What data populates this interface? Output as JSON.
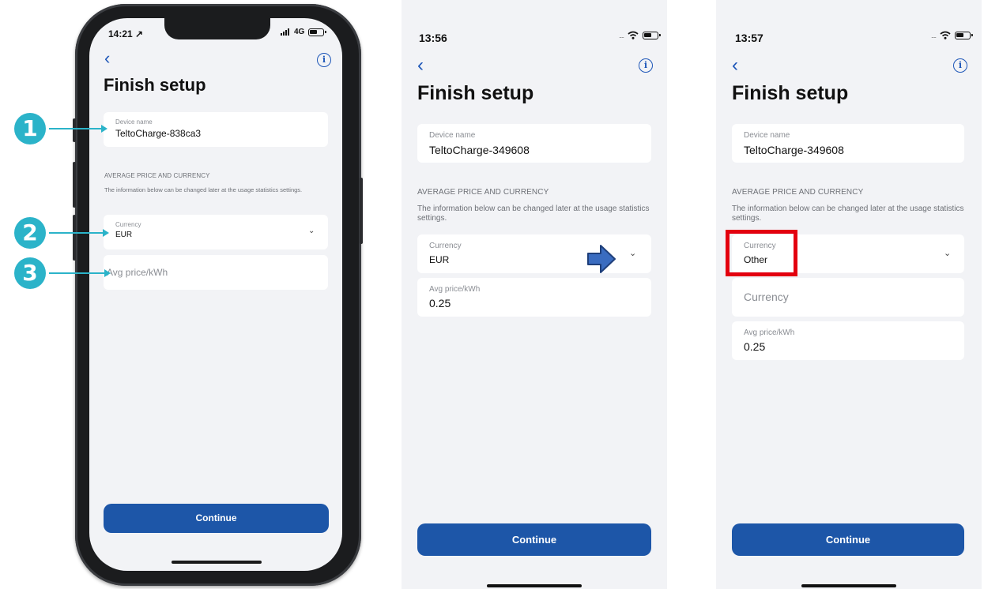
{
  "colors": {
    "accent": "#1d56a8",
    "callout": "#2bb3c9",
    "highlight": "#e3000f",
    "background": "#f2f3f6"
  },
  "screen1": {
    "time": "14:21 ↗",
    "status": "4G",
    "title": "Finish setup",
    "device_label": "Device name",
    "device_value": "TeltoCharge-838ca3",
    "section": "AVERAGE PRICE AND CURRENCY",
    "description": "The information below can be changed later at the usage statistics settings.",
    "currency_label": "Currency",
    "currency_value": "EUR",
    "avg_placeholder": "Avg price/kWh",
    "continue": "Continue",
    "callouts": [
      "1",
      "2",
      "3"
    ]
  },
  "screen2": {
    "time": "13:56",
    "title": "Finish setup",
    "device_label": "Device name",
    "device_value": "TeltoCharge-349608",
    "section": "AVERAGE PRICE AND CURRENCY",
    "description": "The information below can be changed later at the usage statistics settings.",
    "currency_label": "Currency",
    "currency_value": "EUR",
    "avg_label": "Avg price/kWh",
    "avg_value": "0.25",
    "continue": "Continue"
  },
  "screen3": {
    "time": "13:57",
    "title": "Finish setup",
    "device_label": "Device name",
    "device_value": "TeltoCharge-349608",
    "section": "AVERAGE PRICE AND CURRENCY",
    "description": "The information below can be changed later at the usage statistics settings.",
    "currency_label": "Currency",
    "currency_value": "Other",
    "currency_custom_placeholder": "Currency",
    "avg_label": "Avg price/kWh",
    "avg_value": "0.25",
    "continue": "Continue"
  },
  "icons": {
    "back": "chevron-left-icon",
    "info": "info-icon",
    "dropdown": "chevron-down-icon",
    "wifi": "wifi-icon",
    "battery": "battery-icon",
    "signal": "signal-icon",
    "pointer": "arrow-right-icon"
  }
}
